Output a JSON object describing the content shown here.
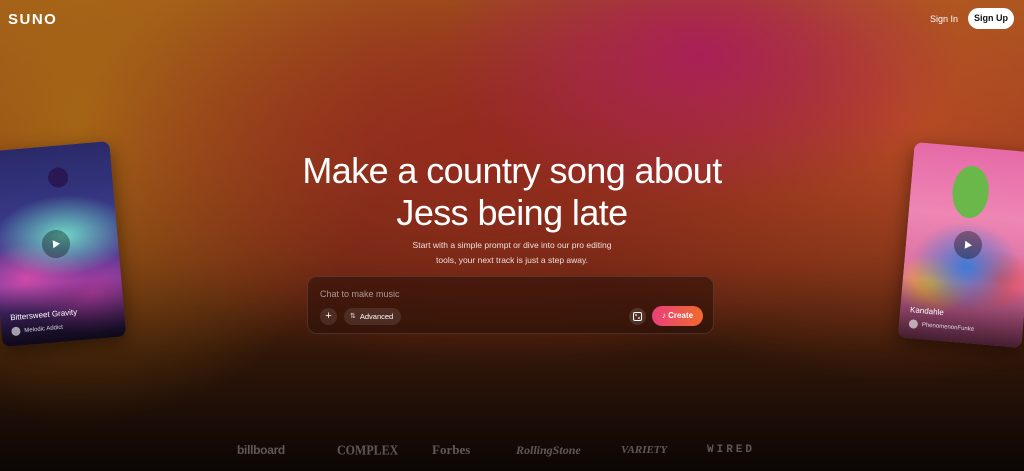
{
  "header": {
    "logo": "SUNO",
    "sign_in": "Sign In",
    "sign_up": "Sign Up"
  },
  "hero": {
    "title_line1": "Make a country song about",
    "title_line2": "Jess being late",
    "subtitle_line1": "Start with a simple prompt or dive into our pro editing",
    "subtitle_line2": "tools, your next track is just a step away."
  },
  "prompt": {
    "placeholder": "Chat to make music",
    "value": "",
    "plus_label": "+",
    "advanced_label": "Advanced",
    "create_label": "Create",
    "create_gradient": [
      "#e9407a",
      "#f06a2c"
    ]
  },
  "cards": {
    "left": {
      "title": "Bittersweet Gravity",
      "artist": "Melodic Addict"
    },
    "right": {
      "title": "Kandahle",
      "artist": "PhenomenonFunke"
    }
  },
  "press": [
    "billboard",
    "COMPLEX",
    "Forbes",
    "RollingStone",
    "VARIETY",
    "WIRED"
  ]
}
